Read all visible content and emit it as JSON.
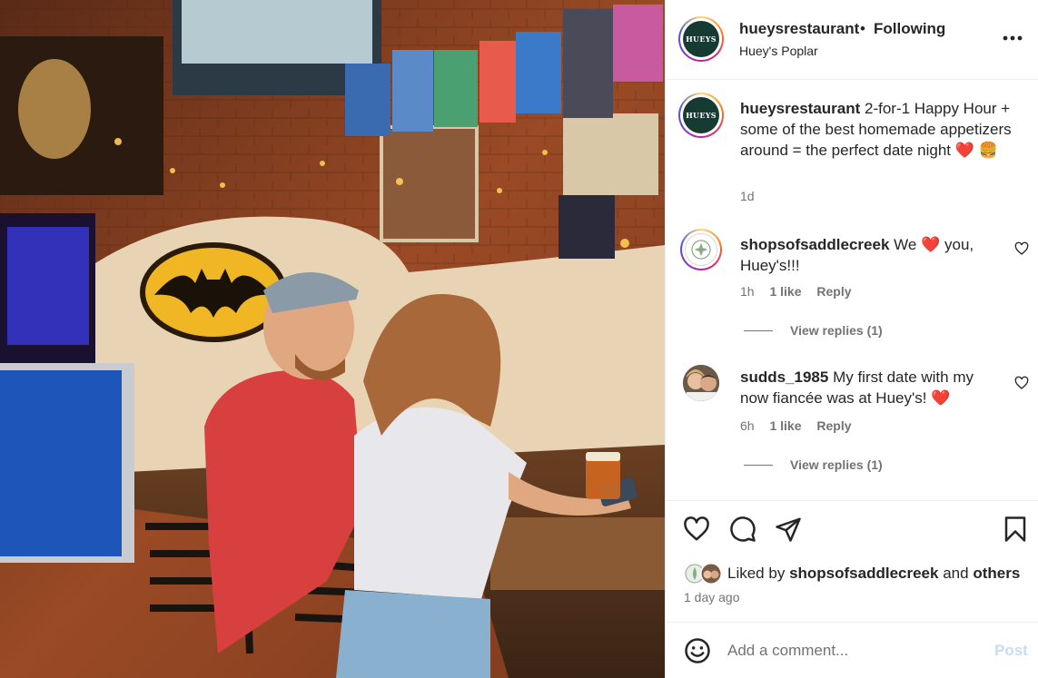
{
  "post_photo": {
    "alt": ""
  },
  "header": {
    "avatar_text": "HUEYS",
    "username": "hueysrestaurant",
    "separator": "•",
    "follow_status": "Following",
    "location": "Huey's Poplar",
    "more_icon": "more-horizontal-icon"
  },
  "caption": {
    "avatar_text": "HUEYS",
    "username": "hueysrestaurant",
    "text": "2-for-1 Happy Hour + some of the best homemade appetizers around = the perfect date night",
    "emojis": "❤️ 🍔",
    "time": "1d"
  },
  "comments": [
    {
      "username": "shopsofsaddlecreek",
      "text_before": "We",
      "emoji": "❤️",
      "text_after": "you, Huey's!!!",
      "time": "1h",
      "likes": "1 like",
      "reply_label": "Reply",
      "view_replies": "View replies (1)"
    },
    {
      "username": "sudds_1985",
      "text_before": "My first date with my now fiancée was at Huey's!",
      "emoji": "❤️",
      "text_after": "",
      "time": "6h",
      "likes": "1 like",
      "reply_label": "Reply",
      "view_replies": "View replies (1)"
    }
  ],
  "actions": {
    "icons": [
      "heart-icon",
      "comment-icon",
      "share-icon",
      "bookmark-icon"
    ],
    "liked_by_prefix": "Liked by",
    "liked_by_user": "shopsofsaddlecreek",
    "liked_by_connector": "and",
    "liked_by_others": "others",
    "post_time": "1 day ago"
  },
  "add_comment": {
    "placeholder": "Add a comment...",
    "post_label": "Post",
    "emoji_icon": "smiley-icon"
  },
  "colors": {
    "text": "#262626",
    "secondary": "#737373",
    "heart_red": "#ed1c24",
    "post_disabled": "#c5dcfa",
    "brand_green": "#163b33"
  }
}
